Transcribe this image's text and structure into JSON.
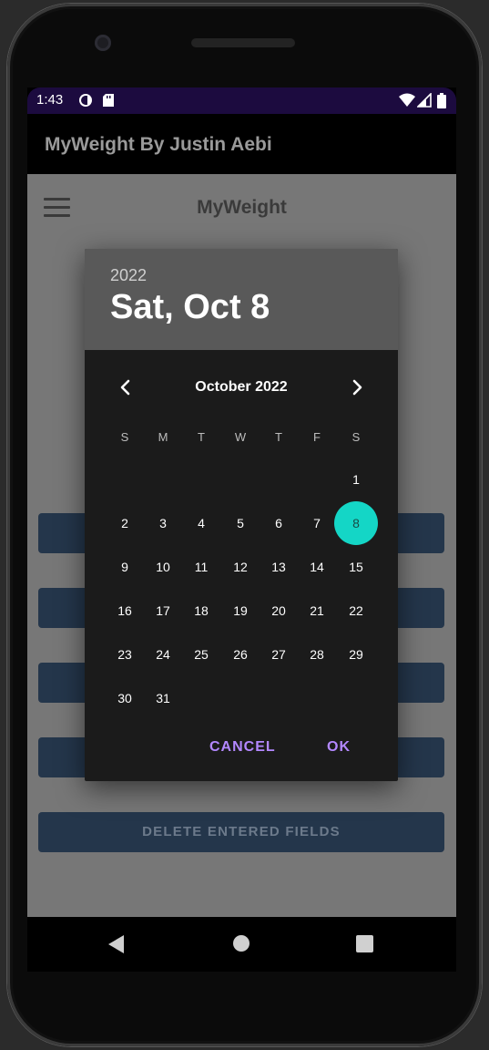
{
  "status_bar": {
    "time": "1:43"
  },
  "app_bar": {
    "title": "MyWeight By Justin Aebi"
  },
  "main": {
    "title": "MyWeight",
    "buttons": [
      {
        "label": ""
      },
      {
        "label": ""
      },
      {
        "label": ""
      },
      {
        "label": ""
      },
      {
        "label": "DELETE ENTERED FIELDS"
      }
    ]
  },
  "date_picker": {
    "selected_year": "2022",
    "selected_date": "Sat, Oct 8",
    "month_label": "October 2022",
    "weekdays": [
      "S",
      "M",
      "T",
      "W",
      "T",
      "F",
      "S"
    ],
    "first_weekday_index": 6,
    "days": [
      "1",
      "2",
      "3",
      "4",
      "5",
      "6",
      "7",
      "8",
      "9",
      "10",
      "11",
      "12",
      "13",
      "14",
      "15",
      "16",
      "17",
      "18",
      "19",
      "20",
      "21",
      "22",
      "23",
      "24",
      "25",
      "26",
      "27",
      "28",
      "29",
      "30",
      "31"
    ],
    "selected_day": "8",
    "cancel_label": "CANCEL",
    "ok_label": "OK"
  },
  "colors": {
    "status_bar": "#1c0b3f",
    "selected_day": "#14d6c6",
    "dialog_action": "#b388ff",
    "button": "#24364b"
  }
}
